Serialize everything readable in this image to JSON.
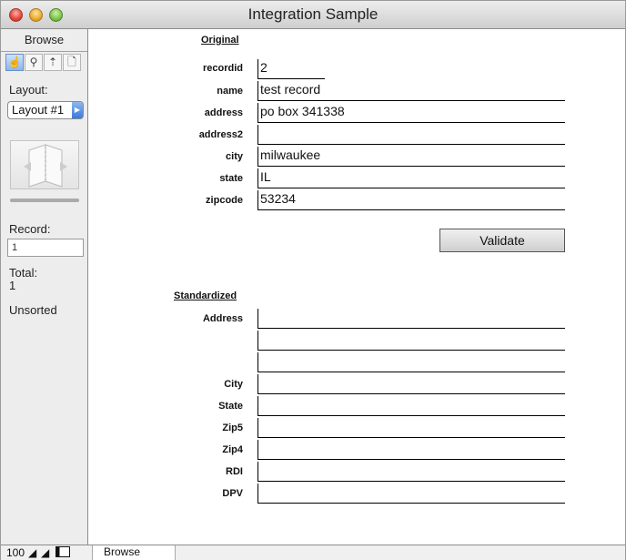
{
  "window": {
    "title": "Integration Sample"
  },
  "sidebar": {
    "mode": "Browse",
    "tools": [
      {
        "icon": "browse-hand-icon",
        "glyph": "☝"
      },
      {
        "icon": "find-icon",
        "glyph": "⚲"
      },
      {
        "icon": "layout-icon",
        "glyph": "⇡"
      },
      {
        "icon": "preview-icon",
        "glyph": "🗋"
      }
    ],
    "layout_label": "Layout:",
    "layout_value": "Layout #1",
    "record_label": "Record:",
    "record_value": "1",
    "total_label": "Total:",
    "total_value": "1",
    "sort_status": "Unsorted"
  },
  "original": {
    "heading": "Original",
    "fields": [
      {
        "label": "recordid",
        "value": "2"
      },
      {
        "label": "name",
        "value": "test record"
      },
      {
        "label": "address",
        "value": "po box 341338"
      },
      {
        "label": "address2",
        "value": ""
      },
      {
        "label": "city",
        "value": "milwaukee"
      },
      {
        "label": "state",
        "value": "IL"
      },
      {
        "label": "zipcode",
        "value": "53234"
      }
    ]
  },
  "validate_label": "Validate",
  "standardized": {
    "heading": "Standardized",
    "address_label": "Address",
    "address_lines": [
      "",
      "",
      ""
    ],
    "fields": [
      {
        "label": "City",
        "value": ""
      },
      {
        "label": "State",
        "value": ""
      },
      {
        "label": "Zip5",
        "value": ""
      },
      {
        "label": "Zip4",
        "value": ""
      },
      {
        "label": "RDI",
        "value": ""
      },
      {
        "label": "DPV",
        "value": ""
      }
    ]
  },
  "status": {
    "zoom": "100",
    "mode": "Browse"
  }
}
